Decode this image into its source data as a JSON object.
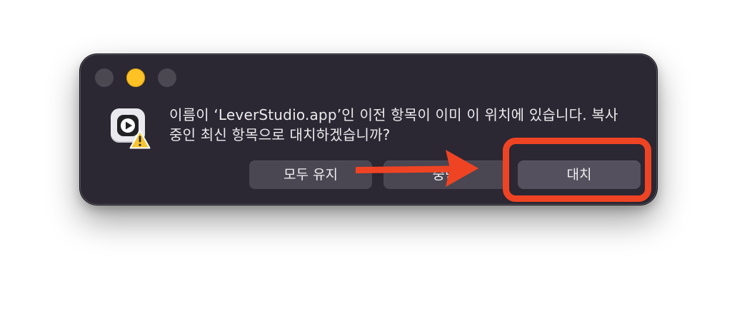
{
  "dialog": {
    "message": "이름이 ‘LeverStudio.app’인 이전 항목이 이미 이 위치에 있습니다. 복사\n중인 최신 항목으로 대치하겠습니까?",
    "buttons": {
      "keep_both": "모두 유지",
      "stop": "중단",
      "replace": "대치"
    },
    "app_icon": "leverstudio-app-icon",
    "warning_icon": "warning-triangle-icon"
  },
  "annotation": {
    "arrow_color": "#ef4424",
    "highlight_color": "#ef4424"
  },
  "colors": {
    "dialog_bg": "#2b2733",
    "button_bg": "#4a4652",
    "minimize_yellow": "#fec225"
  }
}
